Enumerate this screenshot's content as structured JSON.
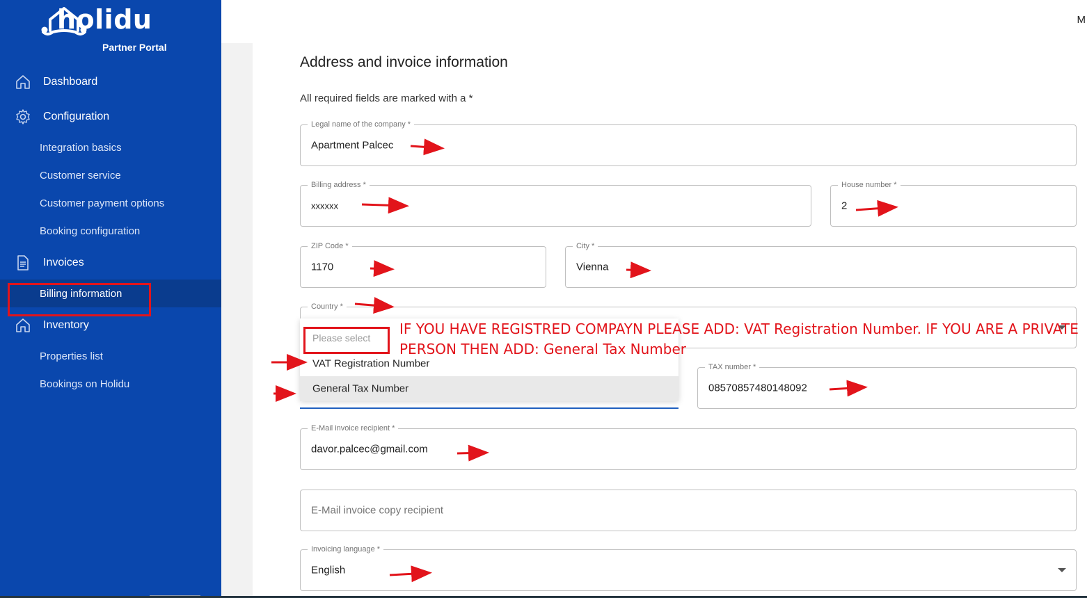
{
  "app": {
    "brand": "holidu",
    "subtitle": "Partner Portal",
    "user_initial": "M"
  },
  "sidebar": {
    "items": [
      {
        "label": "Dashboard",
        "icon": "home-icon"
      },
      {
        "label": "Configuration",
        "icon": "gear-icon"
      },
      {
        "label": "Integration basics"
      },
      {
        "label": "Customer service"
      },
      {
        "label": "Customer payment options"
      },
      {
        "label": "Booking configuration"
      },
      {
        "label": "Invoices",
        "icon": "document-icon"
      },
      {
        "label": "Billing information",
        "active": true
      },
      {
        "label": "Inventory",
        "icon": "home-icon"
      },
      {
        "label": "Properties list"
      },
      {
        "label": "Bookings on Holidu"
      }
    ]
  },
  "form": {
    "title": "Address and invoice information",
    "required_note": "All required fields are marked with a *",
    "company": {
      "label": "Legal name of the company *",
      "value": "Apartment Palcec"
    },
    "billing_address": {
      "label": "Billing address *",
      "value": "xxxxxx"
    },
    "house_number": {
      "label": "House number *",
      "value": "2"
    },
    "zip": {
      "label": "ZIP Code *",
      "value": "1170"
    },
    "city": {
      "label": "City *",
      "value": "Vienna"
    },
    "country": {
      "label": "Country *"
    },
    "tax_type": {
      "placeholder": "Please select",
      "options": [
        "VAT Registration Number",
        "General Tax Number"
      ]
    },
    "tax_number": {
      "label": "TAX number *",
      "value": "08570857480148092"
    },
    "email_recipient": {
      "label": "E-Mail invoice recipient *",
      "value": "davor.palcec@gmail.com"
    },
    "email_copy": {
      "placeholder": "E-Mail invoice copy recipient"
    },
    "language": {
      "label": "Invoicing language *",
      "value": "English"
    }
  },
  "annotation": {
    "line1": "IF YOU HAVE REGISTRED COMPAYN PLEASE ADD: VAT Registration Number. IF YOU ARE A PRIVATE",
    "line2": "PERSON THEN ADD: General Tax Number",
    "color": "#E2141B"
  },
  "colors": {
    "sidebar": "#0A47AD",
    "sidebar_active": "#0A3C8E",
    "annotation_red": "#E2141B"
  }
}
